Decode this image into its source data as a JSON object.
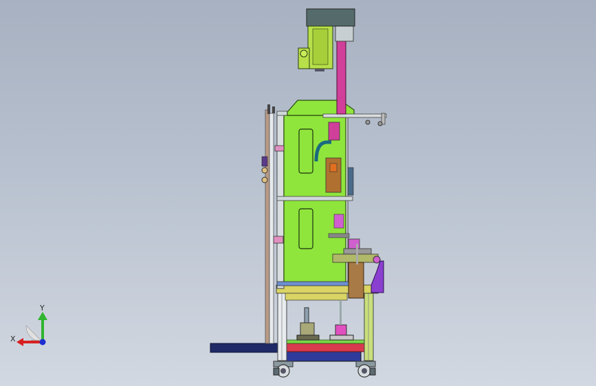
{
  "viewport": {
    "background_top": "#a7b1c1",
    "background_bottom": "#d2d8e1"
  },
  "model": {
    "description_icon": "cad-assembly-side-view",
    "colors": {
      "frame_green": "#8fe53c",
      "profile_grey": "#c7d3d6",
      "motor_green": "#b8e04a",
      "motor_cap": "#556b6b",
      "column_magenta": "#d0409a",
      "table_yellow": "#d9d463",
      "bracket_brown": "#a87a45",
      "base_navy": "#2f3b7a",
      "base_red": "#d83a4e",
      "accent_purple": "#8a3fd0"
    }
  },
  "triad": {
    "x_label": "X",
    "y_label": "Y",
    "x_color": "#d81f1f",
    "y_color": "#2fb52f",
    "origin_color": "#1c2fd0"
  }
}
